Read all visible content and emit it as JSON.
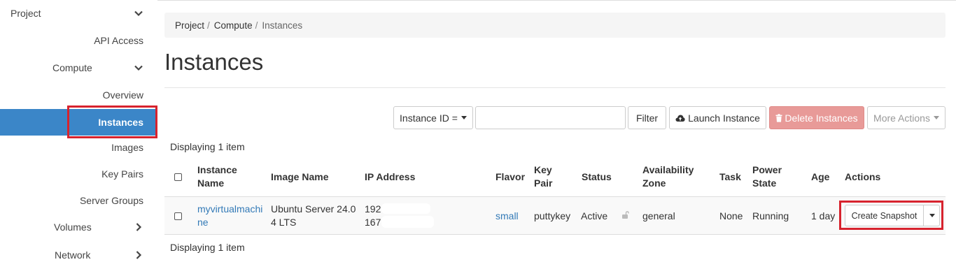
{
  "sidebar": {
    "project_label": "Project",
    "api_access": "API Access",
    "compute_label": "Compute",
    "overview": "Overview",
    "instances": "Instances",
    "images": "Images",
    "key_pairs": "Key Pairs",
    "server_groups": "Server Groups",
    "volumes": "Volumes",
    "network": "Network"
  },
  "breadcrumb": [
    "Project",
    "Compute",
    "Instances"
  ],
  "page_title": "Instances",
  "toolbar": {
    "filter_select": "Instance ID =",
    "filter_input_value": "",
    "filter_button": "Filter",
    "launch_button": "Launch Instance",
    "delete_button": "Delete Instances",
    "more_actions": "More Actions"
  },
  "display_count": "Displaying 1 item",
  "table": {
    "headers": {
      "instance_name": [
        "Instance",
        "Name"
      ],
      "image_name": "Image Name",
      "ip_address": "IP Address",
      "flavor": "Flavor",
      "key_pair": [
        "Key",
        "Pair"
      ],
      "status": "Status",
      "availability_zone": [
        "Availability",
        "Zone"
      ],
      "task": "Task",
      "power_state": [
        "Power",
        "State"
      ],
      "age": "Age",
      "actions": "Actions"
    },
    "rows": [
      {
        "instance_name": [
          "myvirtualmachi",
          "ne"
        ],
        "image_name": [
          "Ubuntu Server 24.0",
          "4 LTS"
        ],
        "ip_address": [
          "192",
          "167"
        ],
        "flavor": "small",
        "key_pair": "puttykey",
        "status": "Active",
        "availability_zone": "general",
        "task": "None",
        "power_state": "Running",
        "age": "1 day",
        "action": "Create Snapshot"
      }
    ]
  },
  "colors": {
    "active_nav": "#3b86c8",
    "highlight_box": "#d7232e",
    "danger_button": "#e89a98",
    "link": "#337ab7"
  }
}
